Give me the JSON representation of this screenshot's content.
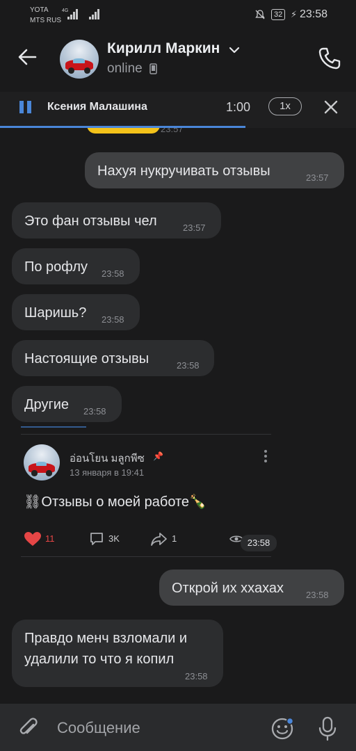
{
  "status_bar": {
    "operator_top": "YOTA",
    "operator_bottom": "MTS RUS",
    "network_type": "4G",
    "battery": "32",
    "time": "23:58"
  },
  "header": {
    "contact_name": "Кирилл Маркин",
    "status": "online",
    "icons": [
      "back-arrow-icon",
      "chevron-down-icon",
      "mobile-icon",
      "phone-icon"
    ]
  },
  "audio_player": {
    "title": "Ксения Малашина",
    "duration": "1:00",
    "speed": "1x",
    "progress": 0.69
  },
  "messages": [
    {
      "text": "Нахуя нукручивать отзывы",
      "time": "23:57",
      "side": "out"
    },
    {
      "text": "Это фан отзывы чел",
      "time": "23:57",
      "side": "in"
    },
    {
      "text": "По рофлу",
      "time": "23:58",
      "side": "in"
    },
    {
      "text": "Шаришь?",
      "time": "23:58",
      "side": "in"
    },
    {
      "text": "Настоящие отзывы",
      "time": "23:58",
      "side": "in"
    },
    {
      "text": "Другие",
      "time": "23:58",
      "side": "in"
    }
  ],
  "partial_time": "23:57",
  "wall_post": {
    "author": "อ่อนโยน มลูกพีซ",
    "date": "13 января в 19:41",
    "text": "⛓Отзывы о моей работе🍾",
    "likes": "11",
    "comments": "3K",
    "reposts": "1",
    "time": "23:58"
  },
  "messages_after": [
    {
      "text": "Открой их ххахах",
      "time": "23:58",
      "side": "out"
    },
    {
      "text_line1": "Правдо менч взломали и",
      "text_line2": "удалили то что я копил",
      "time": "23:58",
      "side": "in"
    }
  ],
  "composer": {
    "placeholder": "Сообщение",
    "icons": [
      "paperclip-icon",
      "emoji-icon",
      "microphone-icon"
    ]
  },
  "colors": {
    "background": "#1a1a1b",
    "incoming": "#2c2d2f",
    "outgoing": "#404143",
    "accent": "#4a86d8",
    "like": "#e64646"
  }
}
